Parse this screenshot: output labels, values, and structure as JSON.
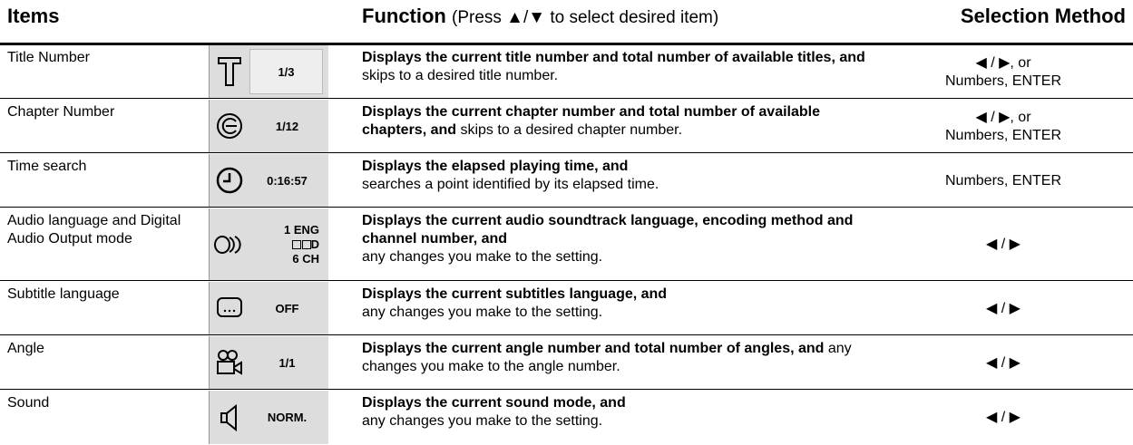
{
  "header": {
    "items": "Items",
    "function_bold": "Function",
    "function_rest": "(Press ▲/▼ to select desired item)",
    "selection": "Selection Method"
  },
  "rows": [
    {
      "item": "Title Number",
      "icon": "title-t-icon",
      "value": "1/3",
      "func_bold": "Displays the current title number and total number of available titles, and",
      "func_rest": " skips to a desired title number.",
      "sel": "◀ / ▶, or\nNumbers, ENTER"
    },
    {
      "item": "Chapter Number",
      "icon": "chapter-c-icon",
      "value": "1/12",
      "func_bold": "Displays the current chapter number and total number of available chapters, and",
      "func_rest": " skips to a desired chapter number.",
      "sel": "◀ / ▶, or\nNumbers, ENTER"
    },
    {
      "item": "Time search",
      "icon": "clock-icon",
      "value": "0:16:57",
      "func_bold": "Displays the elapsed playing time, and",
      "func_rest": "searches a point identified by its elapsed time.",
      "sel": "Numbers, ENTER"
    },
    {
      "item": "Audio language and Digital Audio Output mode",
      "icon": "audio-icon",
      "value_lines": [
        "1  ENG",
        "D",
        "6  CH"
      ],
      "func_bold": "Displays the current audio soundtrack language, encoding method and channel number, and",
      "func_rest": "any changes you make to the setting.",
      "sel": "◀ / ▶"
    },
    {
      "item": "Subtitle language",
      "icon": "subtitle-icon",
      "value": "OFF",
      "func_bold": "Displays the current subtitles language, and",
      "func_rest": "any changes you make to the setting.",
      "sel": "◀ / ▶"
    },
    {
      "item": "Angle",
      "icon": "camera-angle-icon",
      "value": "1/1",
      "func_bold": "Displays the current angle number and total number of angles, and",
      "func_rest": " any changes you make to the angle number.",
      "sel": "◀ / ▶"
    },
    {
      "item": "Sound",
      "icon": "speaker-icon",
      "value": "NORM.",
      "func_bold": "Displays the current sound mode, and",
      "func_rest": "any changes you make to the setting.",
      "sel": "◀ / ▶"
    }
  ]
}
